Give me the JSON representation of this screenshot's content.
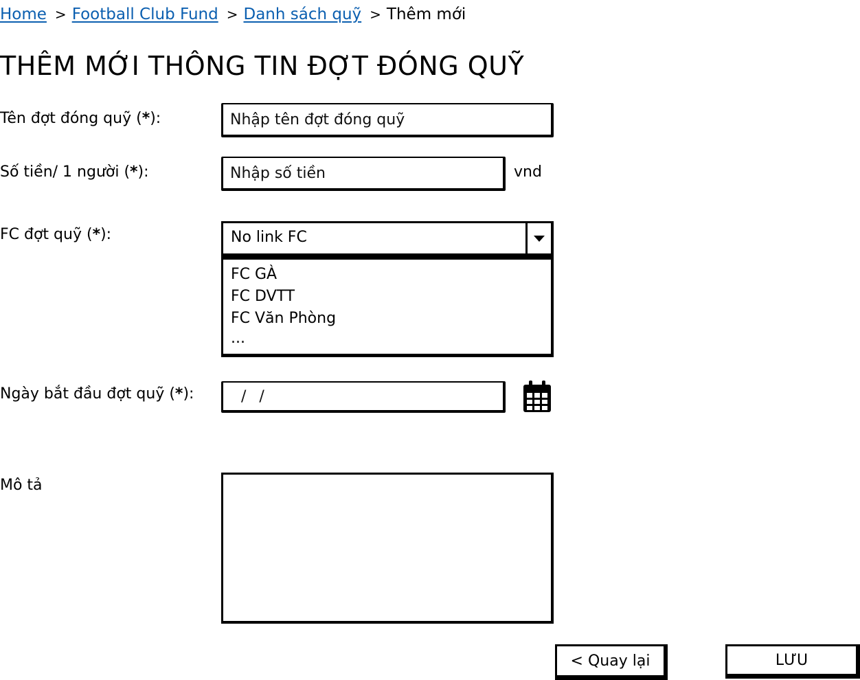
{
  "breadcrumb": {
    "home": "Home",
    "club": "Football Club Fund",
    "list": "Danh sách quỹ",
    "current": "Thêm mới",
    "separator": ">"
  },
  "page": {
    "title": "THÊM MỚI THÔNG TIN ĐỢT ĐÓNG QUỸ"
  },
  "form": {
    "name": {
      "label": "Tên đợt đóng quỹ (",
      "required_mark": "*",
      "label_end": "):",
      "placeholder": "Nhập tên đợt đóng quỹ",
      "value": ""
    },
    "amount": {
      "label": "Số tiền/ 1 người (",
      "required_mark": "*",
      "label_end": "):",
      "placeholder": "Nhập số tiền",
      "value": "",
      "unit": "vnd"
    },
    "fc": {
      "label": "FC đợt quỹ (",
      "required_mark": "*",
      "label_end": "):",
      "selected": "No link FC",
      "options": [
        "FC GÀ",
        "FC DVTT",
        "FC Văn Phòng",
        "..."
      ]
    },
    "start_date": {
      "label": "Ngày bắt đầu đợt quỹ (",
      "required_mark": "*",
      "label_end": "):",
      "value": "/ /"
    },
    "description": {
      "label": "Mô tả",
      "value": ""
    }
  },
  "actions": {
    "back_label": "< Quay lại",
    "save_label": "LƯU"
  },
  "icons": {
    "calendar": "calendar-icon",
    "dropdown": "chevron-down-icon"
  },
  "colors": {
    "link": "#0b5fb0",
    "border": "#000000",
    "background": "#ffffff"
  }
}
